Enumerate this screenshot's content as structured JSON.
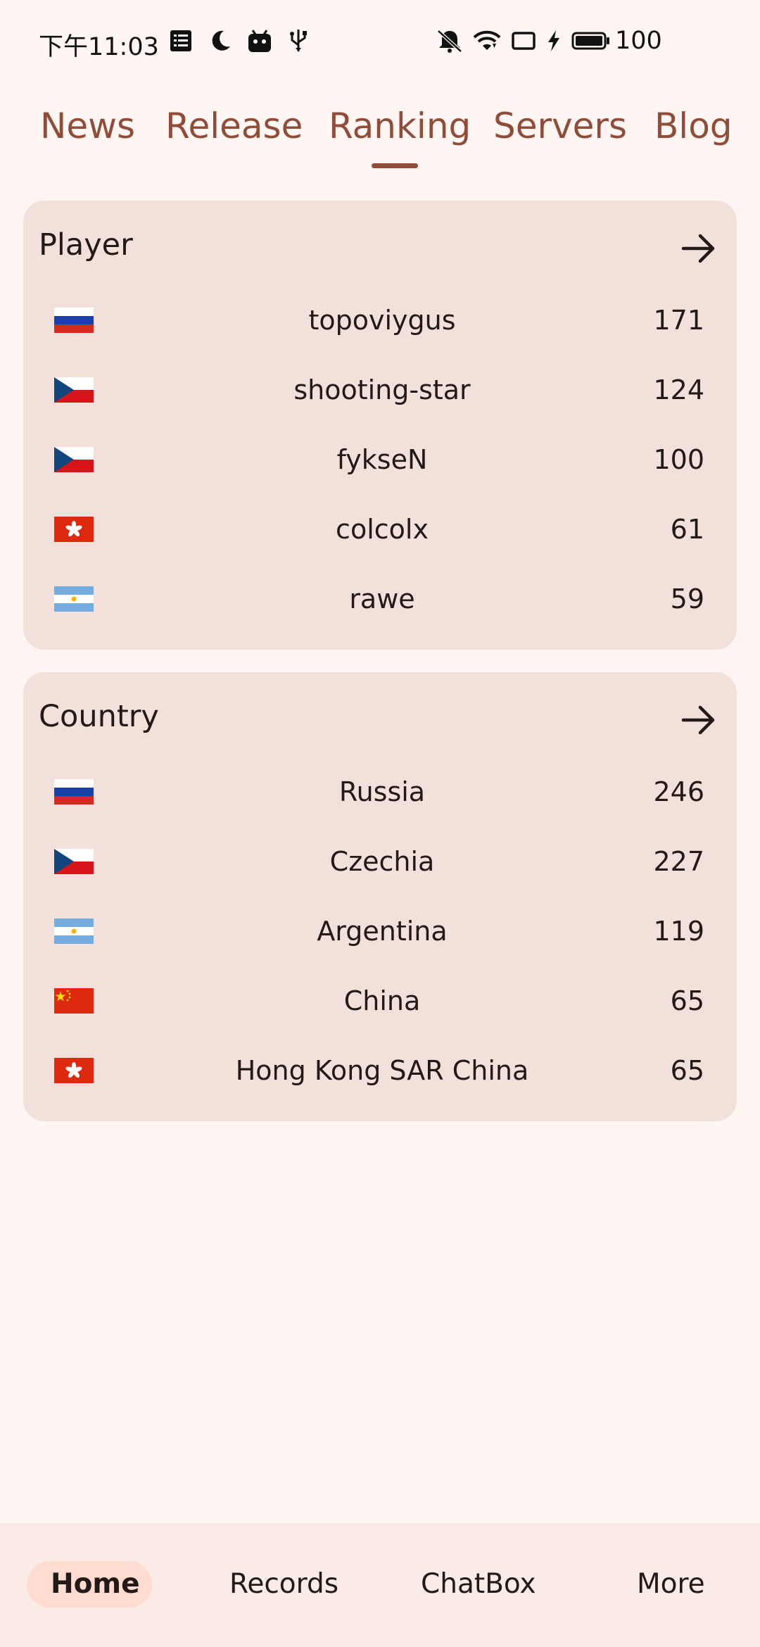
{
  "status_bar": {
    "time": "下午11:03",
    "battery": "100"
  },
  "tabs": [
    {
      "label": "News"
    },
    {
      "label": "Release"
    },
    {
      "label": "Ranking",
      "selected": true
    },
    {
      "label": "Servers"
    },
    {
      "label": "Blog"
    }
  ],
  "player_card": {
    "title": "Player",
    "rows": [
      {
        "flag": "russia",
        "name": "topoviygus",
        "value": "171"
      },
      {
        "flag": "czechia",
        "name": "shooting-star",
        "value": "124"
      },
      {
        "flag": "czechia",
        "name": "fykseN",
        "value": "100"
      },
      {
        "flag": "hong-kong",
        "name": "colcolx",
        "value": "61"
      },
      {
        "flag": "argentina",
        "name": "rawe",
        "value": "59"
      }
    ]
  },
  "country_card": {
    "title": "Country",
    "rows": [
      {
        "flag": "russia",
        "name": "Russia",
        "value": "246"
      },
      {
        "flag": "czechia",
        "name": "Czechia",
        "value": "227"
      },
      {
        "flag": "argentina",
        "name": "Argentina",
        "value": "119"
      },
      {
        "flag": "china",
        "name": "China",
        "value": "65"
      },
      {
        "flag": "hong-kong",
        "name": "Hong Kong SAR China",
        "value": "65"
      }
    ]
  },
  "bottom_nav": [
    {
      "label": "Home",
      "selected": true
    },
    {
      "label": "Records"
    },
    {
      "label": "ChatBox"
    },
    {
      "label": "More"
    }
  ],
  "colors": {
    "accent": "#8f4c38",
    "background": "#fff6f4",
    "card": "#f2e0da",
    "nav_background": "#fbebe6",
    "nav_pill": "#ffdbd0"
  }
}
